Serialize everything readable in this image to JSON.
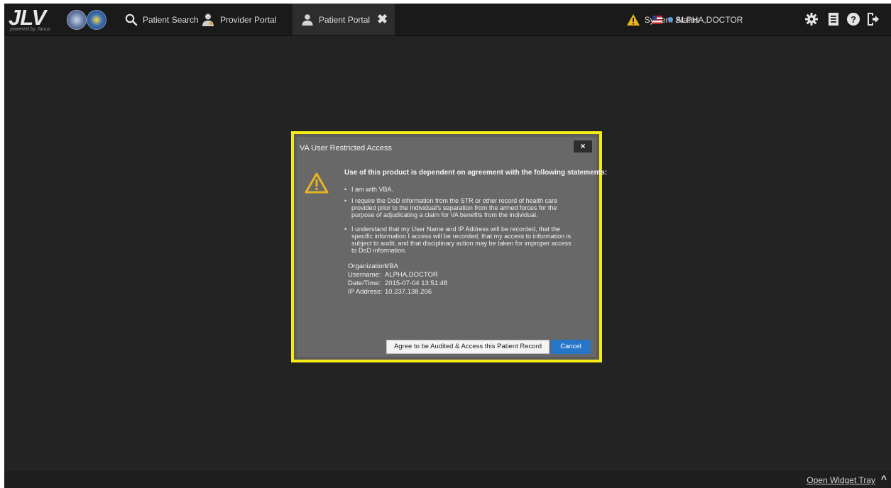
{
  "header": {
    "logo_text": "JLV",
    "logo_powered": "powered by Janus",
    "nav": {
      "patient_search": "Patient Search",
      "provider_portal": "Provider Portal",
      "patient_portal": "Patient Portal"
    },
    "system_status": "System Status",
    "user_name": "ALPHA,DOCTOR",
    "icons": [
      "search-icon",
      "provider-icon",
      "patient-icon",
      "close-icon",
      "warning-icon",
      "flag-icon",
      "gear-icon",
      "document-icon",
      "help-icon",
      "exit-icon"
    ]
  },
  "modal": {
    "title": "VA User Restricted Access",
    "close_label": "×",
    "heading": "Use of this product is dependent on agreement with the following statements:",
    "statements": [
      "I am with VBA.",
      "I require the DoD information from the STR or other record of health care provided prior to the individual's separation from the armed forces for the purpose of adjudicating a claim for VA benefits from the individual.",
      "I understand that my User Name and IP Address will be recorded, that the specific information I access will be recorded, that my access to information is subject to audit, and that disciplinary action may be taken for improper access to DoD information."
    ],
    "bullet": "•",
    "info": {
      "organization_label": "Organization:",
      "organization": "VBA",
      "username_label": "Username:",
      "username": "ALPHA,DOCTOR",
      "datetime_label": "Date/Time:",
      "datetime": "2015-07-04 13:51:48",
      "ip_label": "IP Address:",
      "ip": "10.237.138.206"
    },
    "agree_button": "Agree to be Audited & Access this Patient Record",
    "cancel_button": "Cancel"
  },
  "footer": {
    "widget_tray": "Open Widget Tray",
    "chevron": "^"
  },
  "colors": {
    "highlight": "#f7ec11",
    "cancel": "#2676c8",
    "warning": "#e8b521",
    "user_dot": "#5aa0e6"
  }
}
